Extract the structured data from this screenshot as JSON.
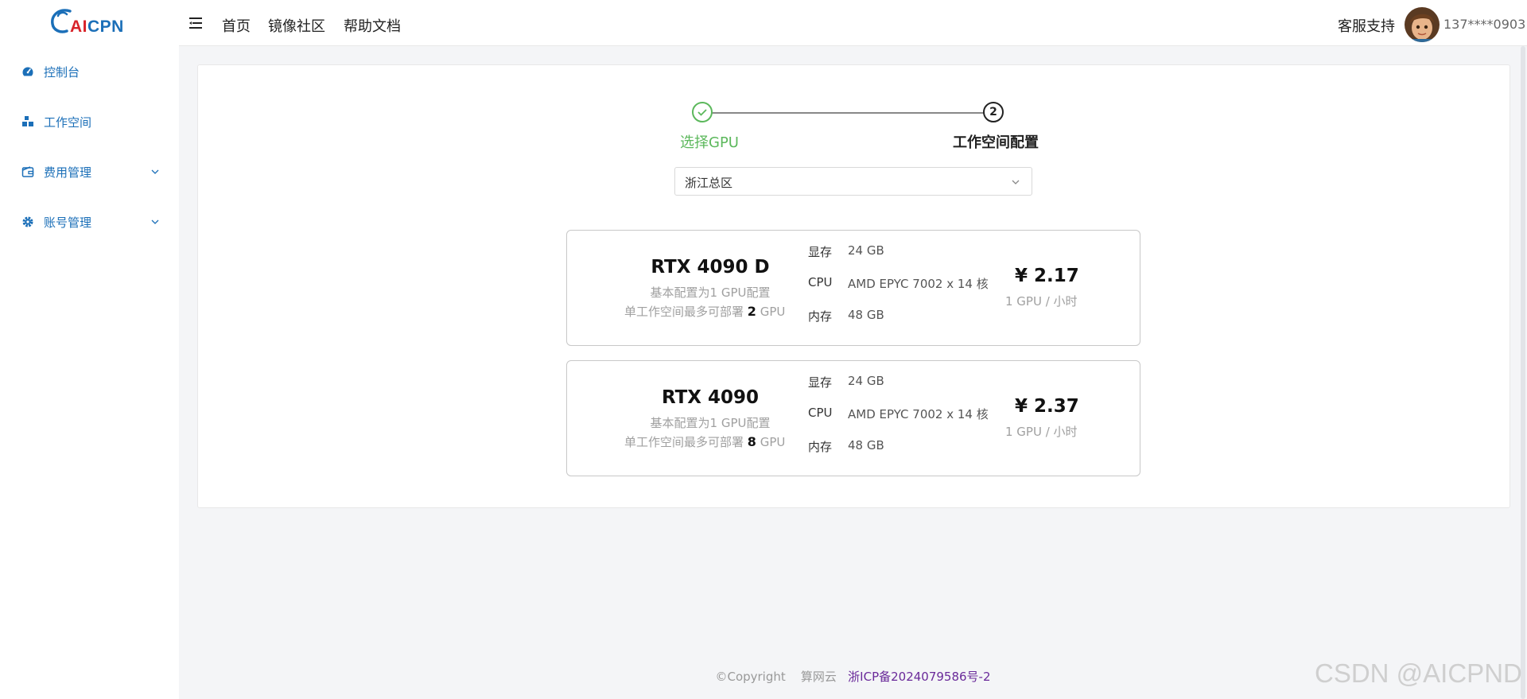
{
  "brand": {
    "logo_text_a": "AI",
    "logo_text_b": "CPN"
  },
  "sidebar": {
    "items": [
      {
        "label": "控制台",
        "icon": "dashboard-icon",
        "has_chevron": false
      },
      {
        "label": "工作空间",
        "icon": "workspace-icon",
        "has_chevron": false
      },
      {
        "label": "费用管理",
        "icon": "wallet-icon",
        "has_chevron": true
      },
      {
        "label": "账号管理",
        "icon": "gear-icon",
        "has_chevron": true
      }
    ]
  },
  "header": {
    "nav": [
      "首页",
      "镜像社区",
      "帮助文档"
    ],
    "support": "客服支持",
    "user_phone": "137****0903"
  },
  "steps": [
    {
      "label": "选择GPU",
      "status": "done"
    },
    {
      "number": "2",
      "label": "工作空间配置",
      "status": "active"
    }
  ],
  "region_select": {
    "value": "浙江总区"
  },
  "gpus": [
    {
      "name": "RTX 4090 D",
      "base": "基本配置为1 GPU配置",
      "max_prefix": "单工作空间最多可部署",
      "max_count": "2",
      "max_suffix": "GPU",
      "specs": [
        {
          "k": "显存",
          "v": "24 GB"
        },
        {
          "k": "CPU",
          "v": "AMD EPYC 7002 x 14 核"
        },
        {
          "k": "内存",
          "v": "48 GB"
        }
      ],
      "price": "¥ 2.17",
      "price_unit": "1 GPU / 小时"
    },
    {
      "name": "RTX 4090",
      "base": "基本配置为1 GPU配置",
      "max_prefix": "单工作空间最多可部署",
      "max_count": "8",
      "max_suffix": "GPU",
      "specs": [
        {
          "k": "显存",
          "v": "24 GB"
        },
        {
          "k": "CPU",
          "v": "AMD EPYC 7002 x 14 核"
        },
        {
          "k": "内存",
          "v": "48 GB"
        }
      ],
      "price": "¥ 2.37",
      "price_unit": "1 GPU / 小时"
    }
  ],
  "footer": {
    "copyright": "©Copyright",
    "company": "算网云",
    "icp": "浙ICP备2024079586号-2"
  },
  "watermark": "CSDN @AICPND",
  "colors": {
    "brand_blue": "#1b6fb8",
    "brand_red": "#d8232a",
    "success_green": "#5cb85c",
    "icp_purple": "#6a2a9a"
  }
}
